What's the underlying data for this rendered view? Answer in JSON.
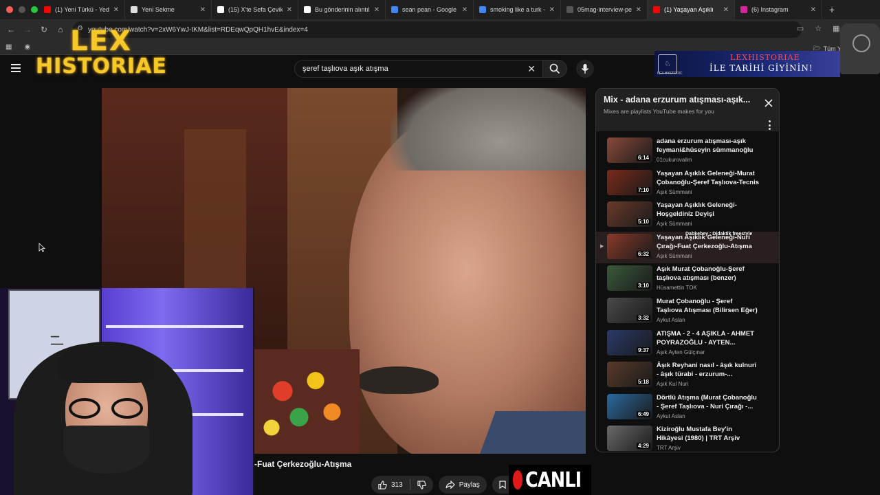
{
  "browser": {
    "tabs": [
      {
        "title": "(1) Yeni Türkü - Yedi",
        "favicon": "youtube-icon",
        "fav_color": "#ff0000",
        "active": false,
        "width": 126
      },
      {
        "title": "Yeni Sekme",
        "favicon": "chrome-icon",
        "fav_color": "#dddddd",
        "active": false,
        "width": 126
      },
      {
        "title": "(15) X'te Sefa Çevik",
        "favicon": "x-icon",
        "fav_color": "#ffffff",
        "active": false,
        "width": 126
      },
      {
        "title": "Bu gönderinin alıntıla",
        "favicon": "x-icon",
        "fav_color": "#ffffff",
        "active": false,
        "width": 127
      },
      {
        "title": "sean pean - Google",
        "favicon": "google-icon",
        "fav_color": "#4285f4",
        "active": false,
        "width": 128
      },
      {
        "title": "smoking like a turk -",
        "favicon": "google-icon",
        "fav_color": "#4285f4",
        "active": false,
        "width": 127
      },
      {
        "title": "05mag-interview-pe",
        "favicon": "page-icon",
        "fav_color": "#555555",
        "active": false,
        "width": 126
      },
      {
        "title": "(1) Yaşayan Aşıklı",
        "favicon": "youtube-icon",
        "fav_color": "#ff0000",
        "active": true,
        "width": 127
      },
      {
        "title": "(6) Instagram",
        "favicon": "instagram-icon",
        "fav_color": "#d6249f",
        "active": false,
        "width": 127
      }
    ],
    "new_tab": "+",
    "url": "youtube.com/watch?v=2xW6YwJ-tKM&list=RDEqwQpQH1hvE&index=4",
    "bookmarks_right": "Tüm Y"
  },
  "logo": {
    "line1": "LEX",
    "line2": "HISTORIAE"
  },
  "youtube": {
    "search_query": "şeref taşlıova aşık atışma",
    "video_title": "-Fuat Çerkezoğlu-Atışma",
    "like_count": "313",
    "share_label": "Paylaş",
    "save_label": "Ka"
  },
  "banner": {
    "brand": "LEXHISTORIAE",
    "slogan": "İLE TARİHİ GİYİNİN!",
    "emblem_text": "LEX HYSTORIC"
  },
  "live_badge": "CANLI",
  "playlist": {
    "title": "Mix - adana erzurum atışması-aşık...",
    "subtitle": "Mixes are playlists YouTube makes for you",
    "items": [
      {
        "title": "adana erzurum atışması-aşık feymani&hüseyin sümmanoğlu",
        "channel": "01cukurovalim",
        "duration": "6:14",
        "thumb": "#8a4a3a",
        "current": false
      },
      {
        "title": "Yaşayan Aşıklık Geleneği-Murat Çobanoğlu-Şeref Taşlıova-Tecnis",
        "channel": "Aşık Sümmani",
        "duration": "7:10",
        "thumb": "#7a2a1a",
        "current": false
      },
      {
        "title": "Yaşayan Aşıklık Geleneği-Hoşgeldiniz Deyişi",
        "channel": "Aşık Sümmani",
        "duration": "5:10",
        "thumb": "#6a3a2a",
        "current": false
      },
      {
        "title": "Yaşayan Aşıklık Geleneği-Nuri Çırağı-Fuat Çerkezoğlu-Atışma",
        "channel": "Aşık Sümmani",
        "duration": "6:32",
        "thumb": "#8a3a2a",
        "current": true,
        "overlay": "Dabkebey : Didaktik freestyle"
      },
      {
        "title": "Aşık Murat Çobanoğlu-Şeref taşlıova atışması (benzer)",
        "channel": "Hüsamettin TOK",
        "duration": "3:10",
        "thumb": "#3a5a3a",
        "current": false
      },
      {
        "title": "Murat Çobanoğlu - Şeref Taşlıova Atışması (Bilirsen Eğer)",
        "channel": "Aykut Aslan",
        "duration": "3:32",
        "thumb": "#4a4a4a",
        "current": false
      },
      {
        "title": "ATIŞMA - 2 - 4 AŞIKLA - AHMET POYRAZOĞLU - AYTEN...",
        "channel": "Aşık Ayten Gülçınar",
        "duration": "9:37",
        "thumb": "#2a3a6a",
        "current": false
      },
      {
        "title": "Âşık Reyhani nasıl - âşık kulnuri - âşık türabi - erzurum-...",
        "channel": "Aşık Kul Nuri",
        "duration": "5:18",
        "thumb": "#5a3a2a",
        "current": false
      },
      {
        "title": "Dörtlü Atışma (Murat Çobanoğlu - Şeref Taşlıova - Nuri Çırağı -...",
        "channel": "Aykut Aslan",
        "duration": "6:49",
        "thumb": "#2a6aa0",
        "current": false
      },
      {
        "title": "Kiziroğlu Mustafa Bey'in Hikâyesi (1980) | TRT Arşiv",
        "channel": "TRT Arşiv",
        "duration": "4:29",
        "thumb": "#6a6a6a",
        "current": false
      }
    ]
  }
}
